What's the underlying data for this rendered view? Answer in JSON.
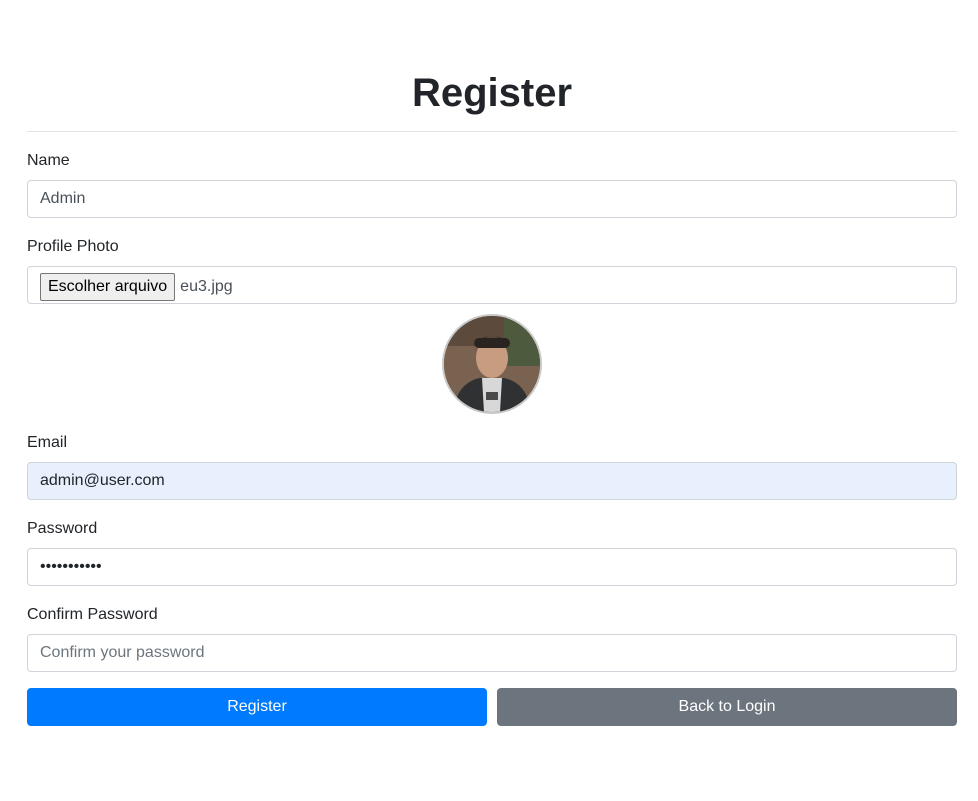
{
  "page": {
    "title": "Register"
  },
  "form": {
    "name": {
      "label": "Name",
      "value": "Admin",
      "placeholder": ""
    },
    "photo": {
      "label": "Profile Photo",
      "button_label": "Escolher arquivo",
      "file_name": "eu3.jpg"
    },
    "email": {
      "label": "Email",
      "value": "admin@user.com"
    },
    "password": {
      "label": "Password",
      "value": "•••••••••••"
    },
    "confirm": {
      "label": "Confirm Password",
      "value": "",
      "placeholder": "Confirm your password"
    }
  },
  "buttons": {
    "register": "Register",
    "back": "Back to Login"
  },
  "colors": {
    "primary": "#007bff",
    "secondary": "#6c757d",
    "autofill": "#e8f0fe"
  }
}
